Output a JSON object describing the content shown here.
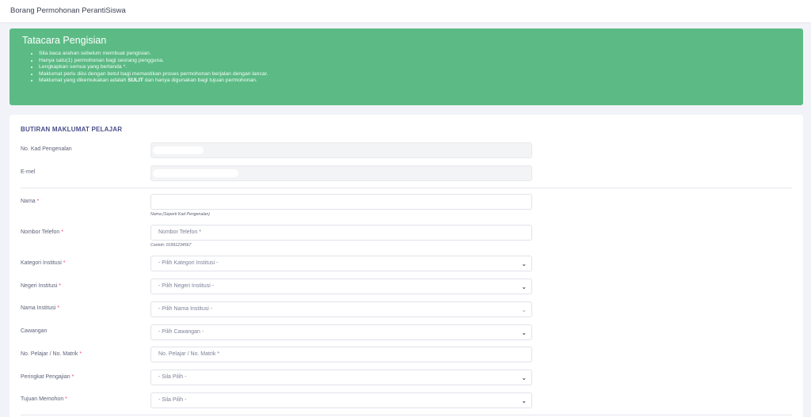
{
  "header": {
    "title": "Borang Permohonan PerantiSiswa"
  },
  "instructions": {
    "title": "Tatacara Pengisian",
    "items": [
      "Sila baca arahan sebelum membuat pengisian.",
      "Hanya satu(1) permohonan bagi seorang pengguna.",
      "Lengkapkan semua yang bertanda *.",
      "Maklumat perlu diisi dengan betul bagi memastikan proses permohonan berjalan dengan lancar."
    ],
    "last_item": {
      "before": "Maklumat yang dikemukakan adalah ",
      "bold": "SULIT",
      "after": " dan hanya digunakan bagi tujuan permohonan."
    },
    "bg_color": "#5cbb85"
  },
  "form": {
    "section_title": "BUTIRAN MAKLUMAT PELAJAR",
    "id_number": {
      "label": "No. Kad Pengenalan"
    },
    "email": {
      "label": "E-mel"
    },
    "name": {
      "label": "Nama",
      "required": "*",
      "hint": "Nama (Seperti Kad Pengenalan)"
    },
    "phone": {
      "label": "Nombor Telefon",
      "required": "*",
      "placeholder": "Nombor Telefon *",
      "hint": "Contoh: 01991234567"
    },
    "institution_category": {
      "label": "Kategori Institusi",
      "required": "*",
      "value": "- Pilih Kategori Institusi -"
    },
    "institution_state": {
      "label": "Negeri Institusi",
      "required": "*",
      "value": "- Pilih Negeri Institusi -"
    },
    "institution_name": {
      "label": "Nama Institusi",
      "required": "*",
      "value": "- Pilih Nama Institusi -"
    },
    "branch": {
      "label": "Cawangan",
      "value": "- Pilih Cawangan -"
    },
    "student_no": {
      "label": "No. Pelajar / No. Matrik",
      "required": "*",
      "placeholder": "No. Pelajar / No. Matrik *"
    },
    "study_level": {
      "label": "Peringkat Pengajian",
      "required": "*",
      "value": "- Sila Pilih -"
    },
    "purpose": {
      "label": "Tujuan Memohon",
      "required": "*",
      "value": "- Sila Pilih -"
    },
    "required_color": "#f1416c"
  }
}
